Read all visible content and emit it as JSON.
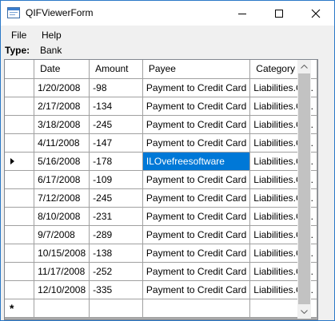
{
  "window": {
    "title": "QIFViewerForm",
    "icon": "app-form-icon",
    "controls": [
      "minimize-icon",
      "maximize-icon",
      "close-icon"
    ]
  },
  "menu": {
    "file": "File",
    "help": "Help"
  },
  "type_row": {
    "label": "Type:",
    "value": "Bank"
  },
  "grid": {
    "columns": [
      "Date",
      "Amount",
      "Payee",
      "Category"
    ],
    "current_row_index": 4,
    "selected_cell": {
      "row": 4,
      "column": "Payee"
    },
    "rows": [
      {
        "date": "1/20/2008",
        "amount": "-98",
        "payee": "Payment to Credit Card",
        "category": "Liabilities.Cr..."
      },
      {
        "date": "2/17/2008",
        "amount": "-134",
        "payee": "Payment to Credit Card",
        "category": "Liabilities.Cr..."
      },
      {
        "date": "3/18/2008",
        "amount": "-245",
        "payee": "Payment to Credit Card",
        "category": "Liabilities.Cr..."
      },
      {
        "date": "4/11/2008",
        "amount": "-147",
        "payee": "Payment to Credit Card",
        "category": "Liabilities.Cr..."
      },
      {
        "date": "5/16/2008",
        "amount": "-178",
        "payee": "ILOvefreesoftware",
        "category": "Liabilities.Cr..."
      },
      {
        "date": "6/17/2008",
        "amount": "-109",
        "payee": "Payment to Credit Card",
        "category": "Liabilities.Cr..."
      },
      {
        "date": "7/12/2008",
        "amount": "-245",
        "payee": "Payment to Credit Card",
        "category": "Liabilities.Cr..."
      },
      {
        "date": "8/10/2008",
        "amount": "-231",
        "payee": "Payment to Credit Card",
        "category": "Liabilities.Cr..."
      },
      {
        "date": "9/7/2008",
        "amount": "-289",
        "payee": "Payment to Credit Card",
        "category": "Liabilities.Cr..."
      },
      {
        "date": "10/15/2008",
        "amount": "-138",
        "payee": "Payment to Credit Card",
        "category": "Liabilities.Cr..."
      },
      {
        "date": "11/17/2008",
        "amount": "-252",
        "payee": "Payment to Credit Card",
        "category": "Liabilities.Cr..."
      },
      {
        "date": "12/10/2008",
        "amount": "-335",
        "payee": "Payment to Credit Card",
        "category": "Liabilities.Cr..."
      }
    ],
    "new_row_marker": "*"
  },
  "colors": {
    "selection": "#0078d7",
    "window_border": "#2b78c7",
    "scrollbar_thumb": "#c2c2c2"
  }
}
